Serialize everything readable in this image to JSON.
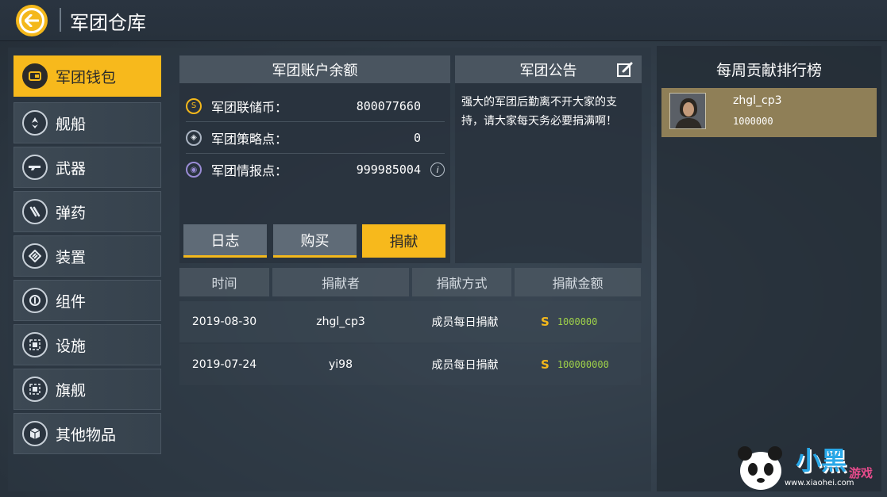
{
  "header": {
    "title": "军团仓库"
  },
  "sidebar": {
    "items": [
      {
        "label": "军团钱包",
        "icon": "wallet-icon",
        "active": true
      },
      {
        "label": "舰船",
        "icon": "ship-icon"
      },
      {
        "label": "武器",
        "icon": "weapon-icon"
      },
      {
        "label": "弹药",
        "icon": "ammo-icon"
      },
      {
        "label": "装置",
        "icon": "device-icon"
      },
      {
        "label": "组件",
        "icon": "component-icon"
      },
      {
        "label": "设施",
        "icon": "facility-icon"
      },
      {
        "label": "旗舰",
        "icon": "flagship-icon"
      },
      {
        "label": "其他物品",
        "icon": "box-icon"
      }
    ]
  },
  "balance": {
    "title": "军团账户余额",
    "rows": [
      {
        "label": "军团联储币：",
        "value": "800077660",
        "icon": "coin-icon"
      },
      {
        "label": "军团策略点：",
        "value": "0",
        "icon": "strategy-icon"
      },
      {
        "label": "军团情报点：",
        "value": "999985004",
        "icon": "intel-icon"
      }
    ],
    "buttons": {
      "log": "日志",
      "buy": "购买",
      "donate": "捐献"
    }
  },
  "notice": {
    "title": "军团公告",
    "text": "强大的军团后勤离不开大家的支持，请大家每天务必要捐满啊！"
  },
  "donations": {
    "columns": [
      "时间",
      "捐献者",
      "捐献方式",
      "捐献金额"
    ],
    "rows": [
      {
        "time": "2019-08-30",
        "donor": "zhgl_cp3",
        "method": "成员每日捐献",
        "amount": "1000000"
      },
      {
        "time": "2019-07-24",
        "donor": "yi98",
        "method": "成员每日捐献",
        "amount": "100000000"
      }
    ]
  },
  "ranking": {
    "title": "每周贡献排行榜",
    "entries": [
      {
        "name": "zhgl_cp3",
        "score": "1000000"
      }
    ]
  },
  "watermark": {
    "brand": "小黑",
    "sub": "游戏",
    "url": "www.xiaohei.com"
  },
  "colors": {
    "accent": "#f7b91c",
    "amount": "#9fd14a",
    "rank_highlight": "#8f7f57"
  }
}
